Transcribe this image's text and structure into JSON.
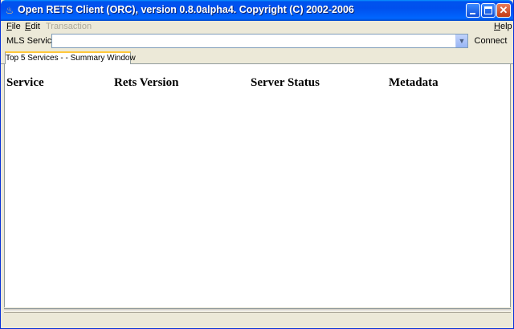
{
  "window": {
    "title": "Open RETS Client (ORC), version 0.8.0alpha4.  Copyright (C) 2002-2006",
    "close_glyph": "✕"
  },
  "menu": {
    "file": "File",
    "edit": "Edit",
    "transaction": "Transaction",
    "help": "Help"
  },
  "service": {
    "label": "MLS Service",
    "selected": "",
    "connect_label": "Connect"
  },
  "tabs": [
    {
      "label": "Top 5 Services - - Summary Window"
    }
  ],
  "table": {
    "columns": [
      "Service",
      "Rets Version",
      "Server Status",
      "Metadata"
    ]
  },
  "colors": {
    "titlebar": "#0053EE",
    "window_bg": "#ECE9D8",
    "tab_accent": "#FFC83C"
  },
  "icons": [
    "java-coffee-icon",
    "minimize-icon",
    "maximize-icon",
    "close-icon",
    "chevron-down-icon"
  ]
}
